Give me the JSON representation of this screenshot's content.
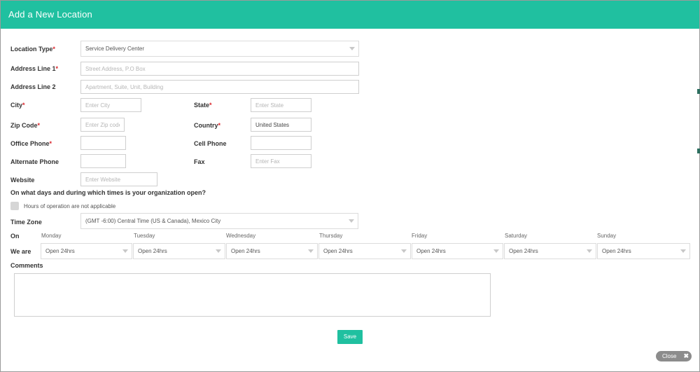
{
  "header": {
    "title": "Add a New Location"
  },
  "form": {
    "location_type": {
      "label": "Location Type",
      "value": "Service Delivery Center"
    },
    "address1": {
      "label": "Address Line 1",
      "placeholder": "Street Address, P.O Box"
    },
    "address2": {
      "label": "Address Line 2",
      "placeholder": "Apartment, Suite, Unit, Building"
    },
    "city": {
      "label": "City",
      "placeholder": "Enter City"
    },
    "state": {
      "label": "State",
      "placeholder": "Enter State"
    },
    "zip": {
      "label": "Zip Code",
      "placeholder": "Enter Zip code"
    },
    "country": {
      "label": "Country",
      "value": "United States"
    },
    "office_phone": {
      "label": "Office Phone"
    },
    "cell_phone": {
      "label": "Cell Phone"
    },
    "alt_phone": {
      "label": "Alternate Phone"
    },
    "fax": {
      "label": "Fax",
      "placeholder": "Enter Fax"
    },
    "website": {
      "label": "Website",
      "placeholder": "Enter Website"
    },
    "required_mark": "*"
  },
  "hours": {
    "question": "On what days and during which times is your organization open?",
    "not_applicable_label": "Hours of operation are not applicable",
    "timezone_label": "Time Zone",
    "timezone_value": "(GMT -6:00) Central Time (US & Canada), Mexico City",
    "on_label": "On",
    "we_are_label": "We are",
    "days": [
      {
        "name": "Monday",
        "value": "Open 24hrs"
      },
      {
        "name": "Tuesday",
        "value": "Open 24hrs"
      },
      {
        "name": "Wednesday",
        "value": "Open 24hrs"
      },
      {
        "name": "Thursday",
        "value": "Open 24hrs"
      },
      {
        "name": "Friday",
        "value": "Open 24hrs"
      },
      {
        "name": "Saturday",
        "value": "Open 24hrs"
      },
      {
        "name": "Sunday",
        "value": "Open 24hrs"
      }
    ]
  },
  "comments": {
    "label": "Comments"
  },
  "actions": {
    "save_label": "Save",
    "close_label": "Close",
    "close_icon": "✖"
  },
  "colors": {
    "accent": "#20c0a0",
    "required": "#d9252b"
  }
}
